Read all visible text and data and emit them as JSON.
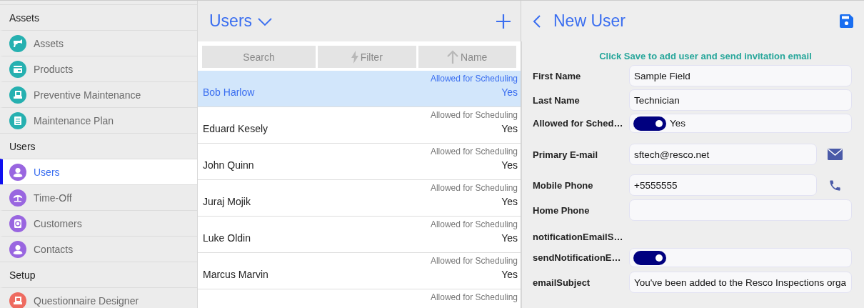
{
  "sidebar": {
    "sections": [
      {
        "title": "Assets",
        "items": [
          {
            "label": "Assets",
            "color": "#26b0b0",
            "selected": false
          },
          {
            "label": "Products",
            "color": "#26b0b0",
            "selected": false
          },
          {
            "label": "Preventive Maintenance",
            "color": "#26b0b0",
            "selected": false
          },
          {
            "label": "Maintenance Plan",
            "color": "#26b0b0",
            "selected": false
          }
        ]
      },
      {
        "title": "Users",
        "items": [
          {
            "label": "Users",
            "color": "#9966e0",
            "selected": true
          },
          {
            "label": "Time-Off",
            "color": "#9966e0",
            "selected": false
          },
          {
            "label": "Customers",
            "color": "#9966e0",
            "selected": false
          },
          {
            "label": "Contacts",
            "color": "#9966e0",
            "selected": false
          }
        ]
      },
      {
        "title": "Setup",
        "items": [
          {
            "label": "Questionnaire Designer",
            "color": "#ee6b60",
            "selected": false
          }
        ]
      }
    ]
  },
  "list": {
    "title": "Users",
    "toolbar": {
      "search": "Search",
      "filter": "Filter",
      "sort": "Name"
    },
    "rows": [
      {
        "name": "Bob Harlow",
        "label": "Allowed for Scheduling",
        "value": "Yes",
        "selected": true
      },
      {
        "name": "Eduard Kesely",
        "label": "Allowed for Scheduling",
        "value": "Yes",
        "selected": false
      },
      {
        "name": "John Quinn",
        "label": "Allowed for Scheduling",
        "value": "Yes",
        "selected": false
      },
      {
        "name": "Juraj Mojik",
        "label": "Allowed for Scheduling",
        "value": "Yes",
        "selected": false
      },
      {
        "name": "Luke Oldin",
        "label": "Allowed for Scheduling",
        "value": "Yes",
        "selected": false
      },
      {
        "name": "Marcus Marvin",
        "label": "Allowed for Scheduling",
        "value": "Yes",
        "selected": false
      },
      {
        "label": "Allowed for Scheduling",
        "selected": false
      }
    ]
  },
  "form": {
    "title": "New User",
    "note": "Click Save to add user and send invitation email",
    "fields": [
      {
        "kind": "text",
        "label": "First Name",
        "value": "Sample Field"
      },
      {
        "kind": "text",
        "label": "Last Name",
        "value": "Technician"
      },
      {
        "kind": "toggle",
        "label": "Allowed for Sched…",
        "on": true,
        "text": "Yes"
      },
      {
        "kind": "email",
        "label": "Primary E-mail",
        "value": "sftech@resco.net"
      },
      {
        "kind": "phone",
        "label": "Mobile Phone",
        "value": "+5555555"
      },
      {
        "kind": "text",
        "label": "Home Phone"
      },
      {
        "kind": "label",
        "label": "notificationEmailS…"
      },
      {
        "kind": "toggle",
        "label": "sendNotificationE…",
        "on": true
      },
      {
        "kind": "text",
        "label": "emailSubject",
        "value": "You've been added to the Resco Inspections orga"
      }
    ]
  }
}
